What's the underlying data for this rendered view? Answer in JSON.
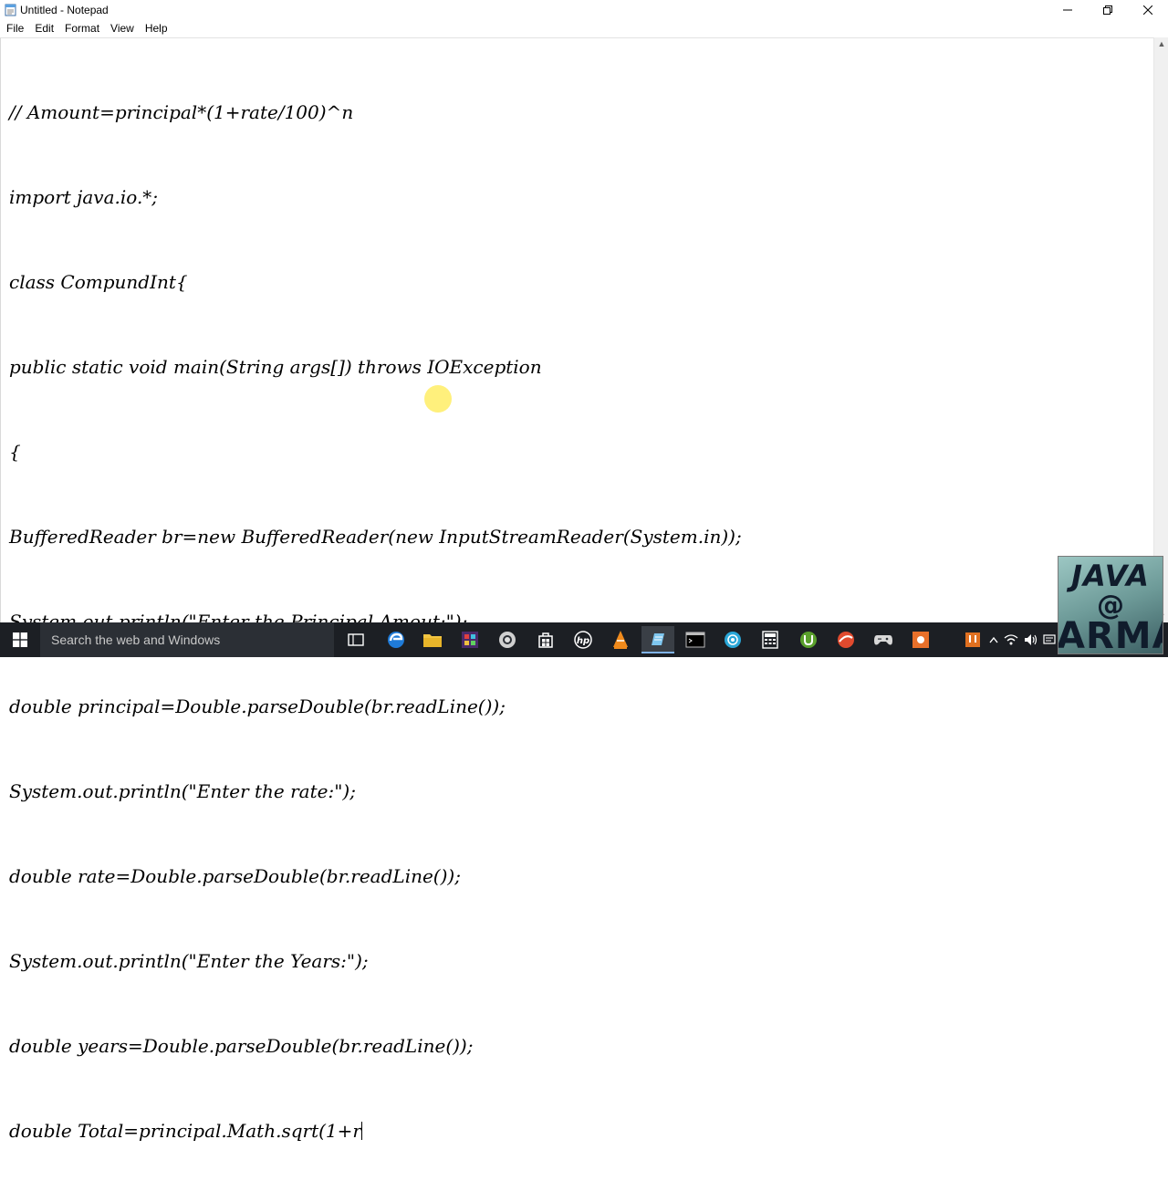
{
  "window": {
    "title": "Untitled - Notepad",
    "controls": {
      "minimize": "—",
      "maximize": "❐",
      "close": "✕"
    }
  },
  "menu": {
    "items": [
      {
        "label": "File"
      },
      {
        "label": "Edit"
      },
      {
        "label": "Format"
      },
      {
        "label": "View"
      },
      {
        "label": "Help"
      }
    ]
  },
  "editor": {
    "lines": [
      "// Amount=principal*(1+rate/100)^n",
      "import java.io.*;",
      "class CompundInt{",
      "public static void main(String args[]) throws IOException",
      "{",
      "BufferedReader br=new BufferedReader(new InputStreamReader(System.in));",
      "System.out.println(\"Enter the Principal Amout:\");",
      "double principal=Double.parseDouble(br.readLine());",
      "System.out.println(\"Enter the rate:\");",
      "double rate=Double.parseDouble(br.readLine());",
      "System.out.println(\"Enter the Years:\");",
      "double years=Double.parseDouble(br.readLine());",
      "double Total=principal.Math.sqrt(1+r"
    ]
  },
  "taskbar": {
    "search_placeholder": "Search the web and Windows",
    "icons": [
      "task-view-icon",
      "edge-icon",
      "file-explorer-icon",
      "app-icon",
      "chrome-icon",
      "store-icon",
      "hp-icon",
      "vlc-icon",
      "notepad-icon",
      "cmd-icon",
      "network-icon",
      "calculator-icon",
      "utorrent-icon",
      "browser-icon",
      "game-icon",
      "app-orange-icon"
    ],
    "active_icon": "notepad-icon"
  },
  "tray": {
    "icons": [
      "show-hidden-icon",
      "network-tray-icon",
      "volume-icon",
      "message-icon"
    ]
  },
  "logo": {
    "line1": "JAVA",
    "line2": "@",
    "line3": "ARMA"
  },
  "colors": {
    "taskbar": "#1c1f24",
    "highlight": "#ffeb50"
  }
}
